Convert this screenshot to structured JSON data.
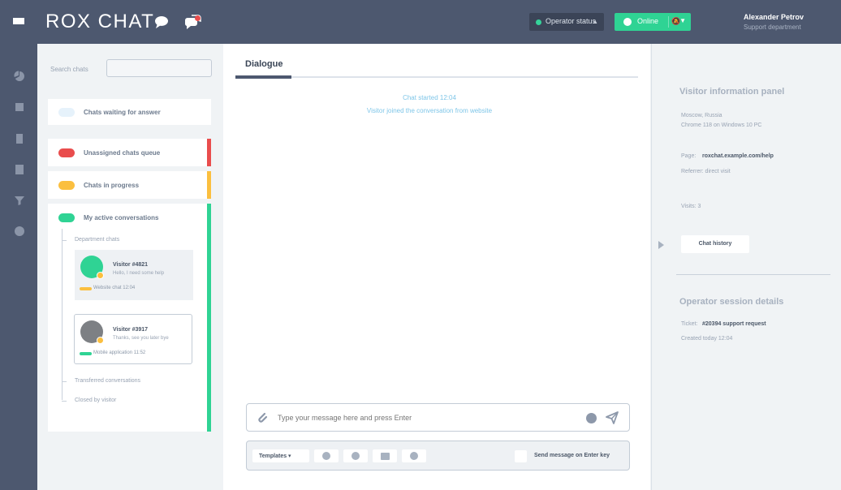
{
  "app": {
    "logo_text": "ROX CHAT"
  },
  "topbar": {
    "status_select_label": "Operator status",
    "online_label": "Online",
    "online_icon": "🔕",
    "user_name": "Alexander Petrov",
    "user_sub": "Support department",
    "colors": {
      "bar": "#4d586f",
      "online": "#2fd394",
      "alert": "#e94d4d"
    }
  },
  "left_nav": {
    "items": [
      "pie-chart-icon",
      "square-icon",
      "document-icon",
      "checklist-icon",
      "filter-icon",
      "circle-icon"
    ]
  },
  "chat_list": {
    "search_label": "Search chats",
    "search_placeholder": "",
    "groups": [
      {
        "title": "Chats waiting for answer",
        "color": "#e6f2fb"
      },
      {
        "title": "Unassigned chats queue",
        "color": "#e94d4d"
      },
      {
        "title": "Chats in progress",
        "color": "#fbbf3f"
      },
      {
        "title": "My active conversations",
        "color": "#2fd394"
      }
    ],
    "subgroups": [
      {
        "title": "Department chats"
      },
      {
        "title": "Transferred conversations"
      },
      {
        "title": "Closed by visitor"
      }
    ],
    "chats": [
      {
        "name": "Visitor #4821",
        "snippet": "Hello, I need some help",
        "meta": "Website chat 12:04",
        "avatar_color": "#2fd394",
        "tag_color": "#fbbf3f"
      },
      {
        "name": "Visitor #3917",
        "snippet": "Thanks, see you later bye",
        "meta": "Mobile application 11:52",
        "avatar_color": "#7d8084",
        "tag_color": "#2fd394"
      }
    ]
  },
  "conversation": {
    "tab_label": "Dialogue",
    "system_msg_1": "Chat started 12:04",
    "system_msg_2": "Visitor joined the conversation from website",
    "message_placeholder": "Type your message here and press Enter",
    "template_label": "Templates ▾",
    "checkbox_label": "Send message on Enter key"
  },
  "info_panel": {
    "visitor_heading": "Visitor information panel",
    "visitor_sub1": "Moscow, Russia",
    "visitor_sub2": "Chrome 118 on Windows 10 PC",
    "key1": "Page:",
    "val1": "roxchat.example.com/help",
    "visitor_sub3": "Referrer: direct visit",
    "visitor_sub4": "Visits: 3",
    "history_button": "Chat history",
    "section2_heading": "Operator session details",
    "key2": "Ticket:",
    "val2": "#20394 support request",
    "section2_sub": "Created today 12:04"
  }
}
